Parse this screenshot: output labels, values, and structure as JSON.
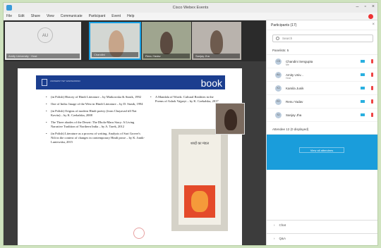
{
  "window": {
    "title": "Cisco Webex Events"
  },
  "menu": [
    "File",
    "Edit",
    "Share",
    "View",
    "Communicate",
    "Participant",
    "Event",
    "Help"
  ],
  "video_strip": {
    "tiles": [
      {
        "initials": "AU",
        "label": "Amity University · Host"
      },
      {
        "label": "Chandini"
      },
      {
        "label": "Renu Yadav"
      },
      {
        "label": "Sanjay Jha"
      }
    ]
  },
  "slide": {
    "banner_title": "book",
    "university": "UNIWERSYTET WARSZAWSKI",
    "left_items": [
      "(in Polish) History of Hindi Literature – by Mutkowska & Stasik, 1992",
      "One of India: Image of the West in Hindi Literature – by D. Stasik, 1994",
      "(in Polish) Origins of modern Hindi poetry (from Chayavad till Nai Kavita) – by K. Czekalska, 2008",
      "The Three abodes of the Desert: The Dhola-Maru Story: A Living Narrative Tradition of Northern India – by A. Tarek, 2012",
      "(in Polish) Literature as a process of writing. Analysis of Suri Grover's Nili in the context of changes in contemporary Hindi prose – by K. Junik-Luniewska, 2015"
    ],
    "right_item": "A Mandala of Words: Cultural Realities in the Poems of Ashok Vajpeyi – by K. Czekalska, 2017",
    "book_cover_text": "शब्दों का मंडल"
  },
  "participants_panel": {
    "title": "Participants (17)",
    "search_placeholder": "Search",
    "panelists_title": "Panelists: 5",
    "people": [
      {
        "name": "Chandini Sengupta",
        "role": "Me",
        "initials": "CS"
      },
      {
        "name": "Amity Univ...",
        "role": "Host",
        "initials": "AU"
      },
      {
        "name": "Kamila Junik",
        "role": "",
        "initials": "KJ"
      },
      {
        "name": "Renu Yadav",
        "role": "",
        "initials": "RY"
      },
      {
        "name": "Sanjay Jha",
        "role": "",
        "initials": "SJ"
      }
    ],
    "attendee_title": "Attendee 12 (0 displayed)",
    "attendee_button": "View all attendees",
    "chat_label": "Chat",
    "qa_label": "Q&A"
  }
}
